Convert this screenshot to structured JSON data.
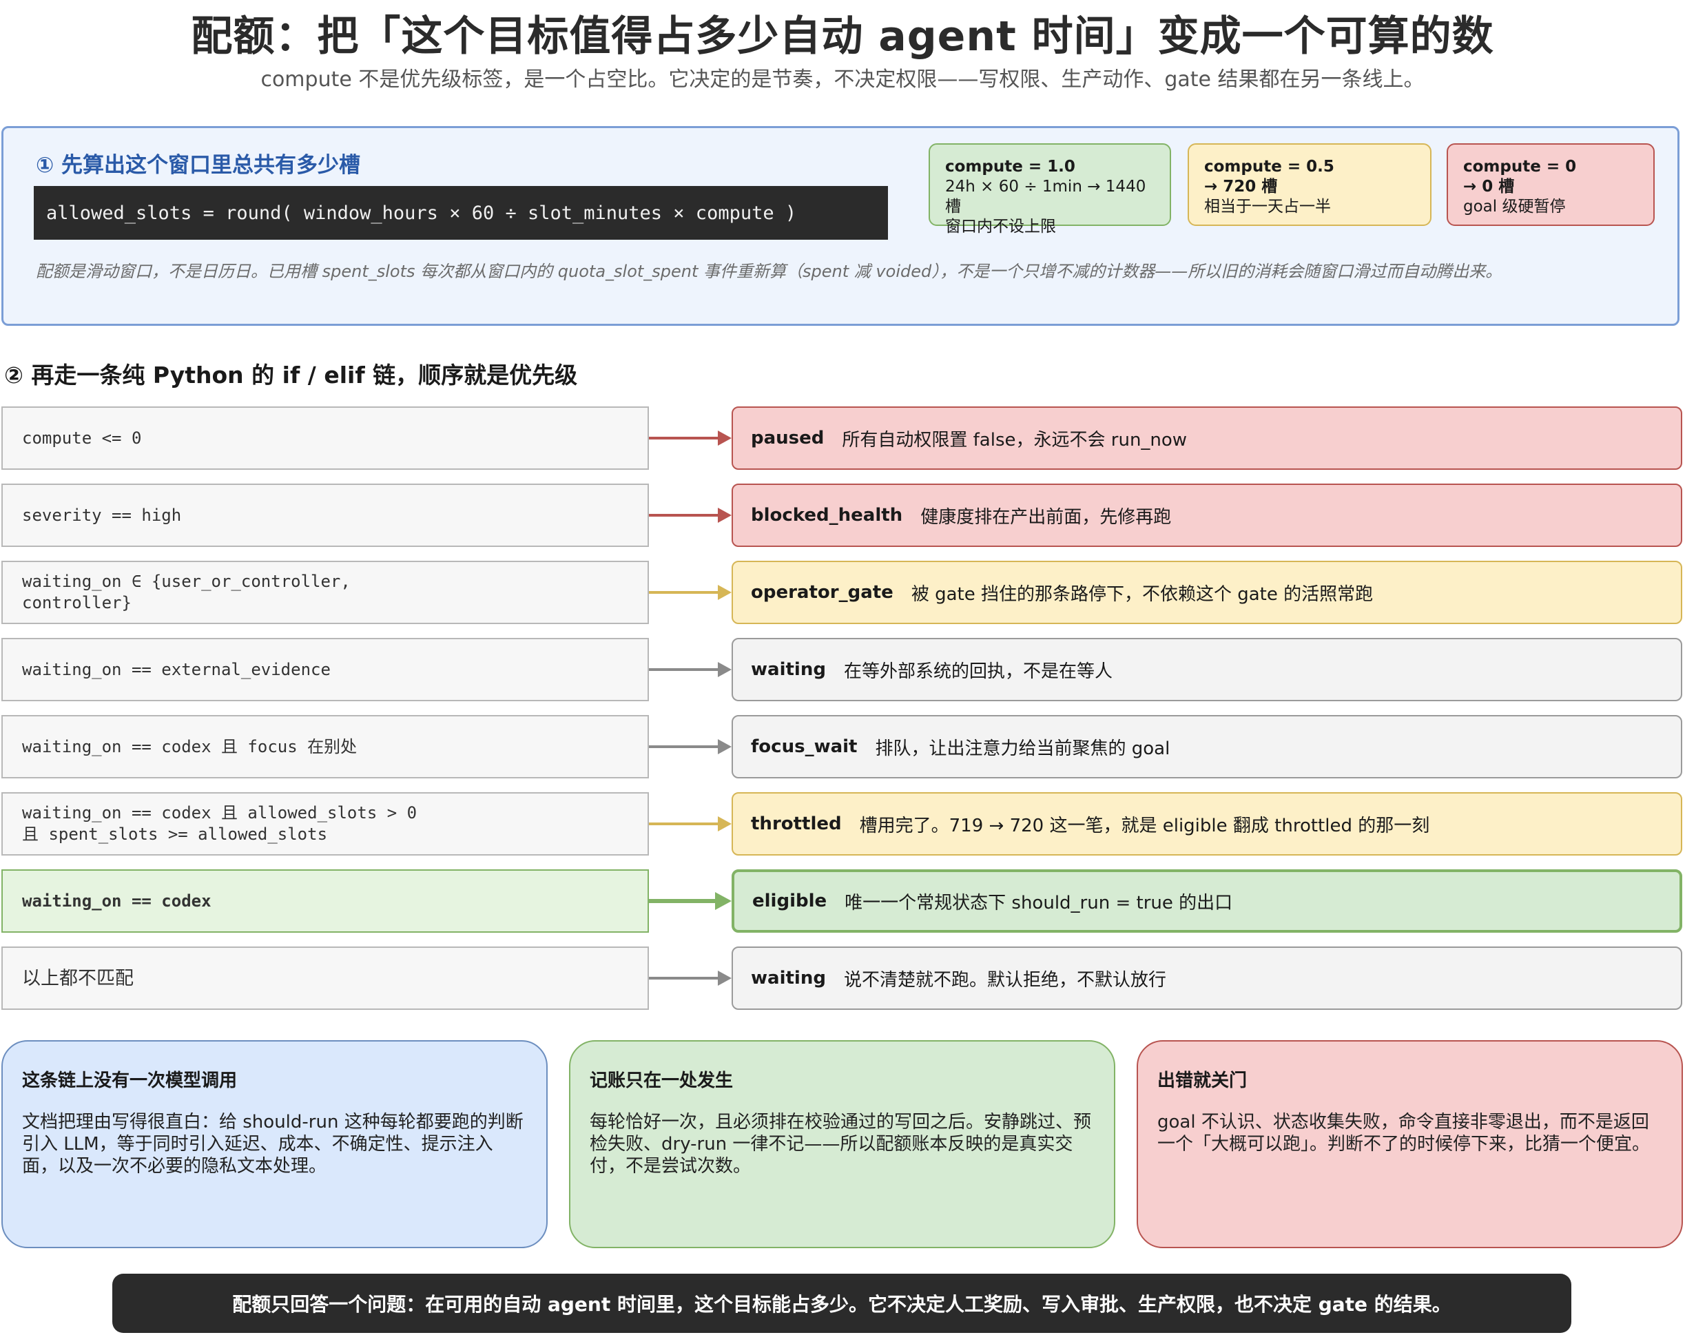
{
  "header": {
    "title": "配额：把「这个目标值得占多少自动 agent 时间」变成一个可算的数",
    "subtitle": "compute 不是优先级标签，是一个占空比。它决定的是节奏，不决定权限——写权限、生产动作、gate 结果都在另一条线上。"
  },
  "section1": {
    "title": "① 先算出这个窗口里总共有多少槽",
    "formula": "allowed_slots = round( window_hours × 60 ÷ slot_minutes × compute )",
    "note": "配额是滑动窗口，不是日历日。已用槽 spent_slots 每次都从窗口内的 quota_slot_spent 事件重新算（spent 减 voided），不是一个只增不减的计数器——所以旧的消耗会随窗口滑过而自动腾出来。",
    "examples": [
      {
        "head": "compute = 1.0",
        "line1": "24h × 60 ÷ 1min → 1440 槽",
        "line2": "窗口内不设上限"
      },
      {
        "head": "compute = 0.5",
        "line1": "→ 720 槽",
        "line2": "相当于一天占一半"
      },
      {
        "head": "compute = 0",
        "line1": "→ 0 槽",
        "line2": "goal 级硬暂停"
      }
    ]
  },
  "section2": {
    "title": "② 再走一条纯 Python 的 if / elif 链，顺序就是优先级",
    "rows": [
      {
        "condition": "compute <= 0",
        "state": "paused",
        "desc": "所有自动权限置 false，永远不会 run_now"
      },
      {
        "condition": "severity == high",
        "state": "blocked_health",
        "desc": "健康度排在产出前面，先修再跑"
      },
      {
        "condition": "waiting_on ∈ {user_or_controller,\ncontroller}",
        "state": "operator_gate",
        "desc": "被 gate 挡住的那条路停下，不依赖这个 gate 的活照常跑"
      },
      {
        "condition": "waiting_on == external_evidence",
        "state": "waiting",
        "desc": "在等外部系统的回执，不是在等人"
      },
      {
        "condition": "waiting_on == codex 且 focus 在别处",
        "state": "focus_wait",
        "desc": "排队，让出注意力给当前聚焦的 goal"
      },
      {
        "condition": "waiting_on == codex 且 allowed_slots > 0\n且 spent_slots >= allowed_slots",
        "state": "throttled",
        "desc": "槽用完了。719 → 720 这一笔，就是 eligible 翻成 throttled 的那一刻"
      },
      {
        "condition": "waiting_on == codex",
        "state": "eligible",
        "desc": "唯一一个常规状态下 should_run = true 的出口"
      },
      {
        "condition": "以上都不匹配",
        "state": "waiting",
        "desc": "说不清楚就不跑。默认拒绝，不默认放行"
      }
    ]
  },
  "cards": [
    {
      "title": "这条链上没有一次模型调用",
      "body": "文档把理由写得很直白：给 should-run 这种每轮都要跑的判断引入 LLM，等于同时引入延迟、成本、不确定性、提示注入面，以及一次不必要的隐私文本处理。"
    },
    {
      "title": "记账只在一处发生",
      "body": "每轮恰好一次，且必须排在校验通过的写回之后。安静跳过、预检失败、dry-run 一律不记——所以配额账本反映的是真实交付，不是尝试次数。"
    },
    {
      "title": "出错就关门",
      "body": "goal 不认识、状态收集失败，命令直接非零退出，而不是返回一个「大概可以跑」。判断不了的时候停下来，比猜一个便宜。"
    }
  ],
  "footer": "配额只回答一个问题：在可用的自动 agent 时间里，这个目标能占多少。它不决定人工奖励、写入审批、生产权限，也不决定 gate 的结果。",
  "colors": {
    "red_fill": "#f7cfcf",
    "red_stroke": "#b85450",
    "yellow_fill": "#fdf0c8",
    "yellow_stroke": "#d6b656",
    "green_fill": "#d6ebd3",
    "green_stroke": "#82b366",
    "grey_fill": "#f3f3f3",
    "grey_stroke": "#9a9a9a",
    "blue_fill": "#dae8fc",
    "blue_stroke": "#6c8ebf"
  }
}
